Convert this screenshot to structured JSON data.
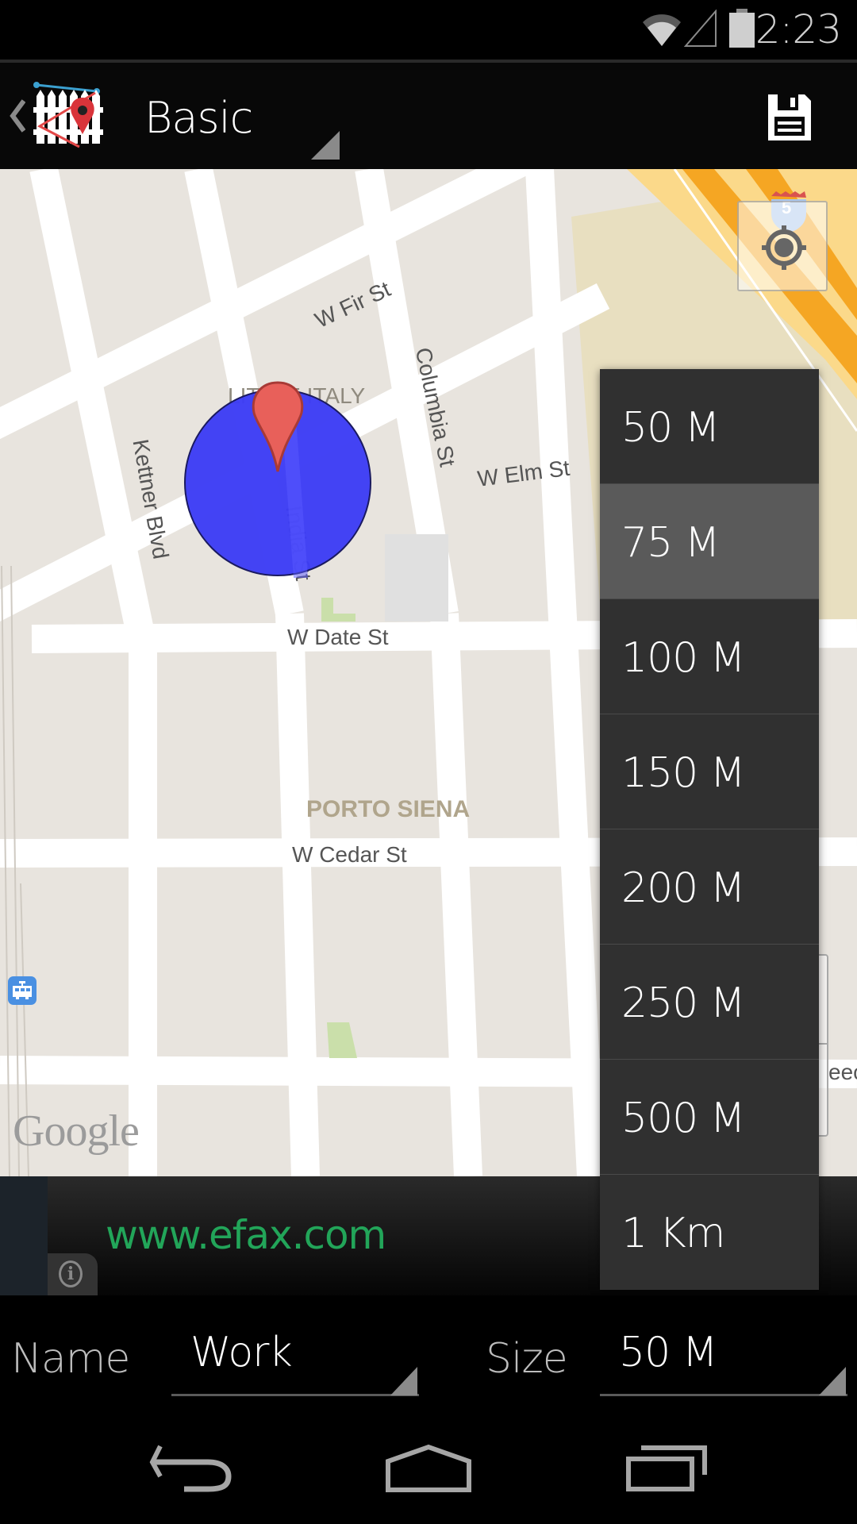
{
  "status_bar": {
    "time": "2:23",
    "icons": [
      "wifi-icon",
      "cell-signal-icon",
      "battery-icon"
    ]
  },
  "action_bar": {
    "up_icon": "chevron-left-icon",
    "app_icon": "geofence-app-icon",
    "title": "Basic",
    "save_icon": "floppy-disk-icon"
  },
  "map": {
    "street_labels": {
      "w_fir": "W Fir St",
      "columbia": "Columbia St",
      "w_elm": "W Elm St",
      "kettner": "Kettner Blvd",
      "india": "India St",
      "w_date": "W Date St",
      "w_cedar": "W Cedar St",
      "partial_right": "eecl"
    },
    "area_labels": {
      "little_italy": "LITTLE ITALY",
      "porto_siena": "PORTO SIENA"
    },
    "highway_shield": "5",
    "attribution": "Google",
    "geofence_color": "#3d3df5",
    "marker_color": "#e8605a",
    "locate_icon": "my-location-icon",
    "transit_icon": "tram-icon"
  },
  "ad": {
    "text": "www.efax.com",
    "text_color": "#22a559",
    "info_icon": "info-icon",
    "info_glyph": "i"
  },
  "form": {
    "name_label": "Name",
    "name_value": "Work",
    "size_label": "Size",
    "size_value": "50 M"
  },
  "size_dropdown": {
    "items": [
      {
        "label": "50 M"
      },
      {
        "label": "75 M"
      },
      {
        "label": "100 M"
      },
      {
        "label": "150 M"
      },
      {
        "label": "200 M"
      },
      {
        "label": "250 M"
      },
      {
        "label": "500 M"
      },
      {
        "label": "1 Km"
      }
    ],
    "highlighted_index": 1
  },
  "nav_bar": {
    "back_icon": "back-icon",
    "home_icon": "home-icon",
    "recents_icon": "recent-apps-icon"
  }
}
